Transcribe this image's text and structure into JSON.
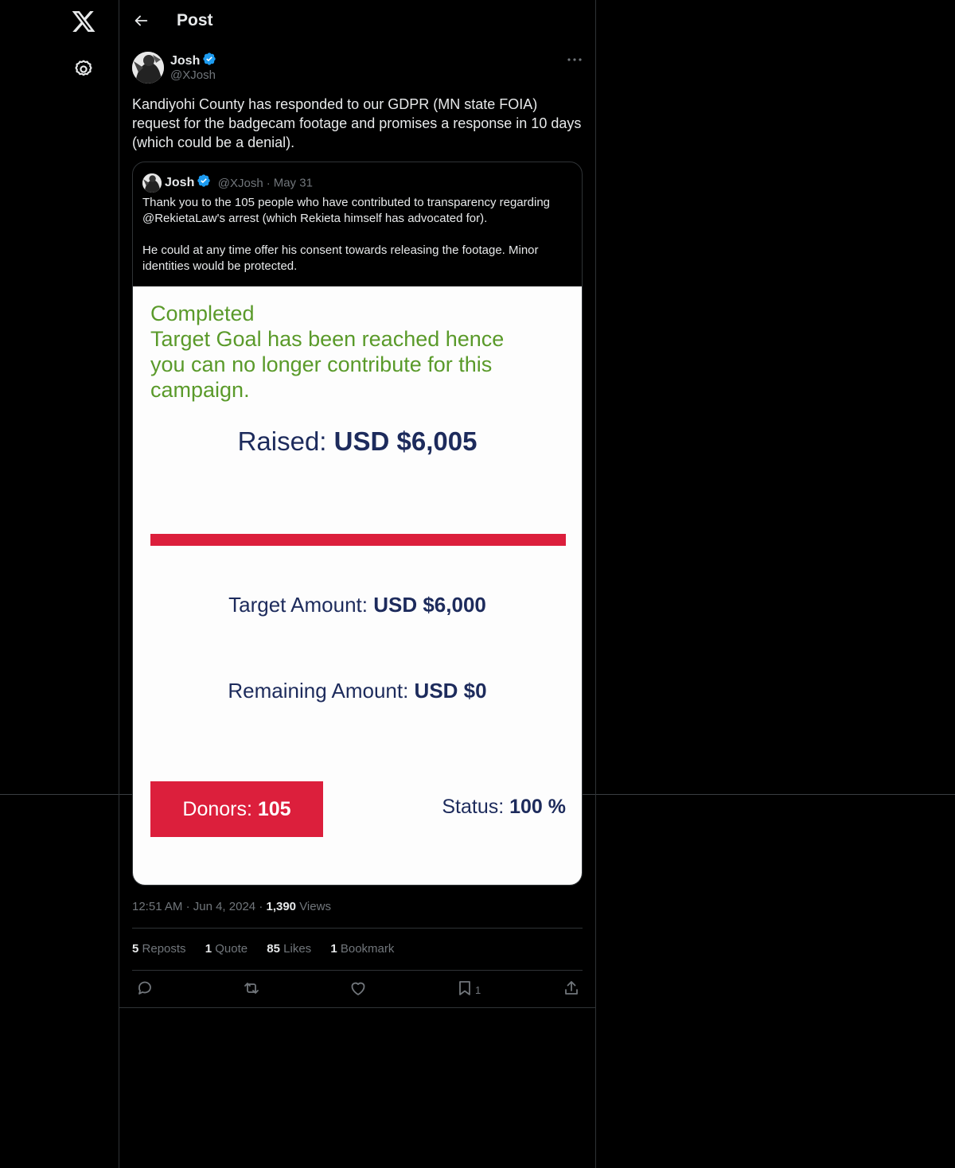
{
  "header": {
    "title": "Post"
  },
  "post": {
    "author_name": "Josh",
    "author_handle": "@XJosh",
    "text": "Kandiyohi County has responded to our GDPR (MN state FOIA) request for the badgecam footage and promises a response in 10 days (which could be a denial).",
    "time": "12:51 AM",
    "date": "Jun 4, 2024",
    "views_count": "1,390",
    "views_label": "Views"
  },
  "quote": {
    "author_name": "Josh",
    "author_handle": "@XJosh",
    "separator": "·",
    "date": "May 31",
    "paragraph1": "Thank you to the 105 people who have contributed to transparency regarding @RekietaLaw's arrest (which Rekieta himself has advocated for).",
    "paragraph2": "He could at any time offer his consent towards releasing the footage. Minor identities would be protected."
  },
  "card": {
    "status_lines": [
      "Completed",
      "Target Goal has been reached hence",
      "you can no longer contribute for this",
      "campaign."
    ],
    "raised_label": "Raised: ",
    "raised_value": "USD $6,005",
    "progress_fraction": 1.0,
    "target_label": "Target Amount: ",
    "target_value": "USD $6,000",
    "remaining_label": "Remaining Amount: ",
    "remaining_value": "USD $0",
    "donors_label": "Donors: ",
    "donors_value": "105",
    "status_label": "Status: ",
    "status_value": "100 %"
  },
  "stats": {
    "reposts_count": "5",
    "reposts_label": "Reposts",
    "quotes_count": "1",
    "quotes_label": "Quote",
    "likes_count": "85",
    "likes_label": "Likes",
    "bookmarks_count": "1",
    "bookmarks_label": "Bookmark"
  },
  "actions": {
    "bookmark_count": "1"
  },
  "icons": {
    "logo": "x-logo-icon",
    "settings": "gear-icon",
    "back": "back-arrow-icon",
    "more": "more-icon",
    "verified": "verified-badge-icon",
    "reply": "reply-icon",
    "repost": "repost-icon",
    "like": "heart-icon",
    "bookmark": "bookmark-icon",
    "share": "share-icon"
  },
  "colors": {
    "background": "#000000",
    "text": "#e7e9ea",
    "muted": "#71767b",
    "border": "#2f3336",
    "verified": "#1d9bf0",
    "card_green": "#5a9a2a",
    "card_navy": "#1d2b5c",
    "card_red": "#dc1f3c"
  }
}
